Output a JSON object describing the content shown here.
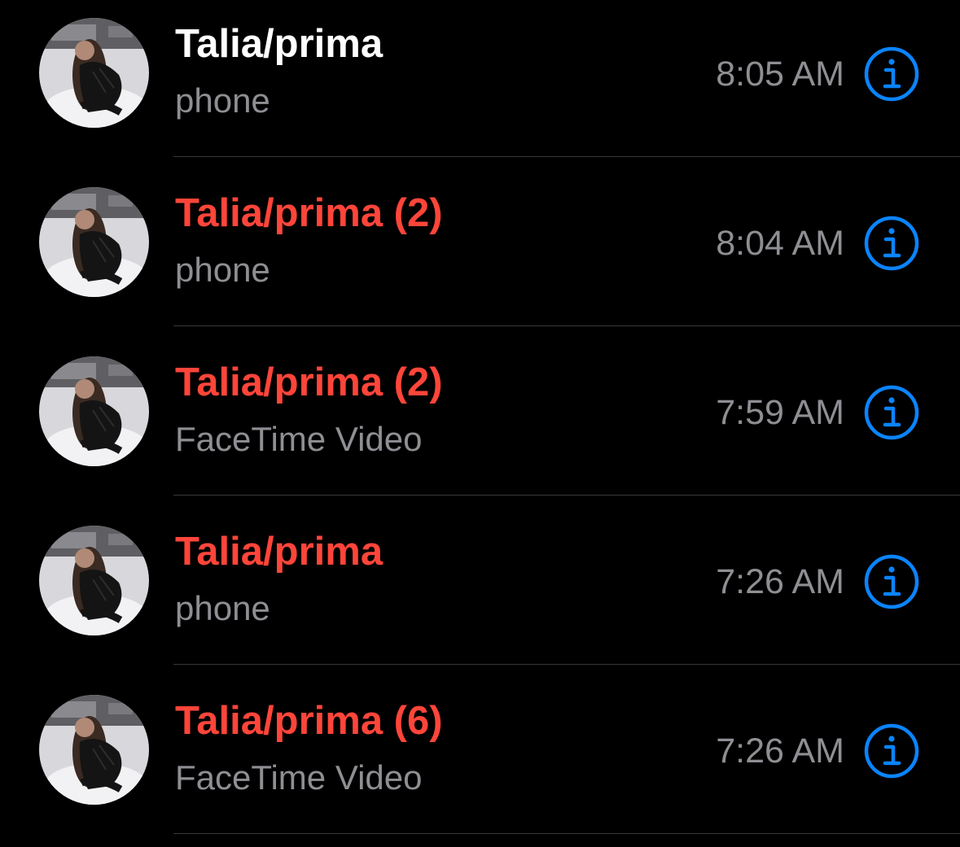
{
  "colors": {
    "missed": "#ff453a",
    "answered": "#ffffff",
    "secondary": "#8e8e93",
    "accent": "#0a84ff",
    "separator": "#38383a"
  },
  "calls": [
    {
      "name": "Talia/prima",
      "status": "answered",
      "type": "phone",
      "time": "8:05 AM",
      "icon": "info-icon"
    },
    {
      "name": "Talia/prima (2)",
      "status": "missed",
      "type": "phone",
      "time": "8:04 AM",
      "icon": "info-icon"
    },
    {
      "name": "Talia/prima (2)",
      "status": "missed",
      "type": "FaceTime Video",
      "time": "7:59 AM",
      "icon": "info-icon"
    },
    {
      "name": "Talia/prima",
      "status": "missed",
      "type": "phone",
      "time": "7:26 AM",
      "icon": "info-icon"
    },
    {
      "name": "Talia/prima (6)",
      "status": "missed",
      "type": "FaceTime Video",
      "time": "7:26 AM",
      "icon": "info-icon"
    }
  ]
}
